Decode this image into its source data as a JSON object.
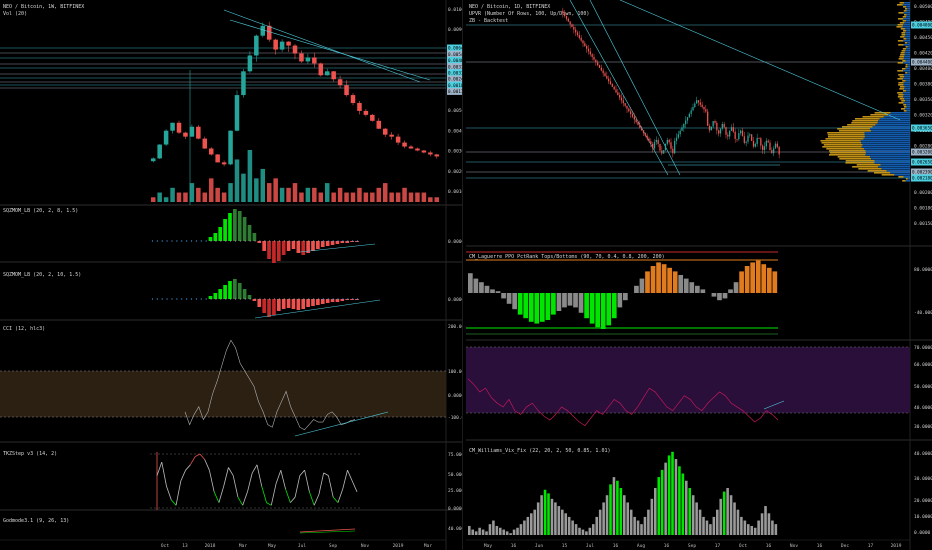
{
  "left_pane": {
    "title": "NEO / Bitcoin, 1W, BITFINEX",
    "volume_label": "Vol (20)",
    "price_ticks": [
      "0.010000",
      "0.009000",
      "0.008000",
      "0.007000",
      "0.006000",
      "0.005000",
      "0.004000",
      "0.003000",
      "0.002000",
      "0.001000"
    ],
    "price_tags": [
      "0.006470",
      "0.005490",
      "0.004690",
      "0.003720",
      "0.003120",
      "0.002400",
      "0.001830",
      "0.001160"
    ],
    "x_ticks": [
      "Oct",
      "13",
      "2018",
      "Mar",
      "May",
      "Jul",
      "Sep",
      "Nov",
      "2019",
      "Mar"
    ],
    "indicator_titles": {
      "sqz1": "SQZMOM_LB (20, 2, 8, 1.5)",
      "sqz2": "SQZMOM_LB (20, 2, 10, 1.5)",
      "cci": "CCI (12, hlc3)",
      "tkz": "TKZStep v3 (14, 2)",
      "godmode": "Godmode3.1 (9, 26, 13)"
    },
    "cci_ticks": [
      "200.0000",
      "100.0000",
      "0.0000",
      "-100.0000"
    ],
    "tkz_ticks": [
      "75.0000",
      "50.0000",
      "25.0000",
      "0.0000"
    ],
    "sqz_ticks": [
      "0.0000"
    ],
    "godmode_ticks": [
      "40.0000"
    ]
  },
  "right_pane": {
    "title": "NEO / Bitcoin, 1D, BITFINEX",
    "subtitle1": "UPVR (Number Of Rows, 100, Up/Down, 100)",
    "subtitle2": "ZB - Backtest",
    "price_ticks": [
      "0.005000",
      "0.004800",
      "0.004500",
      "0.004200",
      "0.004000",
      "0.003800",
      "0.003500",
      "0.003200",
      "0.003000",
      "0.002800",
      "0.002500",
      "0.002300",
      "0.002000",
      "0.001800",
      "0.001500"
    ],
    "price_tags": [
      "0.004800",
      "0.004400",
      "0.003650",
      "0.003200",
      "0.002650",
      "0.002390",
      "0.002180"
    ],
    "x_ticks": [
      "May",
      "16",
      "Jun",
      "15",
      "Jul",
      "16",
      "Aug",
      "16",
      "Sep",
      "17",
      "Oct",
      "16",
      "Nov",
      "16",
      "Dec",
      "17",
      "2019"
    ],
    "indicator_titles": {
      "laguerre": "CM_Laguerre PPO PctRank Tops/Bottoms (90, 70, 0.4, 0.8, 200, 200)",
      "rsi": "RSI (14, close)",
      "williams": "CM_Williams_Vix_Fix (22, 20, 2, 50, 0.85, 1.01)"
    },
    "laguerre_ticks": [
      "80.0000",
      "-40.0000"
    ],
    "rsi_ticks": [
      "70.0000",
      "60.0000",
      "50.0000",
      "40.0000",
      "30.0000"
    ],
    "williams_ticks": [
      "40.0000",
      "30.0000",
      "20.0000",
      "10.0000",
      "0.0000"
    ]
  },
  "colors": {
    "background": "#000000",
    "bull": "#26a69a",
    "bear": "#ef5350",
    "trendline": "#4dd0e1",
    "bull_dark": "#2e7d32",
    "bright_green": "#00e600",
    "orange": "#e07b1e",
    "rsi": "#c2185b",
    "rsi_band": "#2a0f3a",
    "cci_band": "#2b2012",
    "grey": "#9e9e9e",
    "blue_profile": "#1565c0",
    "gold_profile": "#d4a017"
  },
  "chart_data": [
    {
      "type": "line",
      "title": "NEO / Bitcoin, 1W, BITFINEX",
      "series": [],
      "x": [
        "Oct",
        "13",
        "2018",
        "Mar",
        "May",
        "Jul",
        "Sep",
        "Nov",
        "2019",
        "Mar"
      ],
      "weekly_close": [
        0.0028,
        0.0035,
        0.0042,
        0.0046,
        0.0041,
        0.0039,
        0.0044,
        0.0038,
        0.0033,
        0.003,
        0.0026,
        0.0025,
        0.0042,
        0.006,
        0.0072,
        0.008,
        0.009,
        0.0095,
        0.0088,
        0.0083,
        0.0087,
        0.0085,
        0.0081,
        0.0077,
        0.0079,
        0.0076,
        0.007,
        0.0072,
        0.0068,
        0.0065,
        0.006,
        0.0056,
        0.0052,
        0.005,
        0.0047,
        0.0043,
        0.004,
        0.0039,
        0.0036,
        0.0034,
        0.0033,
        0.0032,
        0.0031,
        0.003,
        0.0029
      ],
      "ylim": [
        0.0008,
        0.0105
      ]
    },
    {
      "type": "bar",
      "title": "Vol (20)",
      "values": [
        1,
        2,
        1,
        3,
        2,
        2,
        4,
        3,
        2,
        5,
        3,
        2,
        4,
        9,
        6,
        11,
        5,
        7,
        4,
        5,
        3,
        3,
        4,
        2,
        3,
        3,
        2,
        4,
        2,
        3,
        2,
        2,
        3,
        2,
        2,
        3,
        4,
        2,
        2,
        3,
        2,
        2,
        2,
        1,
        1
      ]
    },
    {
      "type": "line",
      "title": "CCI (12, hlc3)",
      "values": [
        -60,
        -110,
        -70,
        -40,
        -90,
        -60,
        10,
        60,
        120,
        180,
        220,
        190,
        130,
        100,
        70,
        40,
        -20,
        -60,
        -110,
        -120,
        -60,
        -20,
        20,
        -40,
        -80,
        -120,
        -130,
        -110,
        -90,
        -100,
        -100,
        -70,
        -60,
        -80,
        -110,
        -105,
        -95,
        -90
      ],
      "ylim": [
        -170,
        260
      ]
    },
    {
      "type": "line",
      "title": "TKZStep v3 (14, 2)",
      "values": [
        60,
        85,
        40,
        15,
        5,
        50,
        70,
        80,
        95,
        100,
        90,
        70,
        30,
        10,
        40,
        75,
        60,
        20,
        5,
        30,
        65,
        80,
        40,
        10,
        5,
        45,
        70,
        35,
        10,
        20,
        60,
        70,
        30,
        5,
        25,
        65,
        60,
        20,
        10,
        35,
        70,
        50,
        30
      ],
      "ylim": [
        -5,
        110
      ]
    },
    {
      "type": "area",
      "title": "CM_Laguerre PPO PctRank Tops/Bottoms (90, 70, 0.4, 0.8, 200, 200)",
      "values": [
        55,
        40,
        30,
        20,
        10,
        5,
        -15,
        -30,
        -45,
        -60,
        -70,
        -80,
        -85,
        -80,
        -75,
        -60,
        -50,
        -40,
        -35,
        -40,
        -55,
        -70,
        -85,
        -95,
        -100,
        -90,
        -70,
        -40,
        -20,
        0,
        20,
        40,
        60,
        75,
        85,
        80,
        70,
        60,
        50,
        40,
        30,
        20,
        10,
        0,
        -10,
        -20,
        -15,
        10,
        30,
        60,
        75,
        85,
        90,
        80,
        70,
        60
      ],
      "ylim": [
        -110,
        110
      ]
    },
    {
      "type": "line",
      "title": "RSI (14, close)",
      "values": [
        55,
        52,
        48,
        50,
        45,
        42,
        40,
        44,
        38,
        36,
        40,
        42,
        38,
        35,
        33,
        36,
        40,
        38,
        35,
        32,
        30,
        34,
        38,
        36,
        40,
        44,
        42,
        38,
        36,
        40,
        45,
        50,
        48,
        44,
        40,
        38,
        42,
        46,
        44,
        40,
        38,
        42,
        45,
        48,
        46,
        42,
        40,
        38,
        35,
        32,
        34,
        38,
        36,
        33
      ],
      "ylim": [
        25,
        72
      ]
    },
    {
      "type": "bar",
      "title": "CM_Williams_Vix_Fix (22, 20, 2, 50, 0.85, 1.01)",
      "values": [
        5,
        3,
        2,
        4,
        3,
        2,
        6,
        8,
        5,
        4,
        3,
        2,
        1,
        3,
        4,
        6,
        8,
        10,
        12,
        14,
        18,
        22,
        25,
        23,
        20,
        18,
        16,
        14,
        12,
        10,
        8,
        6,
        4,
        3,
        2,
        4,
        6,
        10,
        14,
        18,
        22,
        28,
        32,
        30,
        26,
        22,
        18,
        14,
        10,
        8,
        6,
        10,
        14,
        20,
        26,
        32,
        36,
        40,
        44,
        46,
        42,
        38,
        34,
        30,
        26,
        22,
        18,
        14,
        10,
        8,
        6,
        10,
        14,
        20,
        24,
        26,
        22,
        18,
        14,
        10,
        8,
        6,
        5,
        4,
        8,
        12,
        16,
        12,
        8,
        6
      ],
      "ylim": [
        0,
        47
      ]
    }
  ]
}
